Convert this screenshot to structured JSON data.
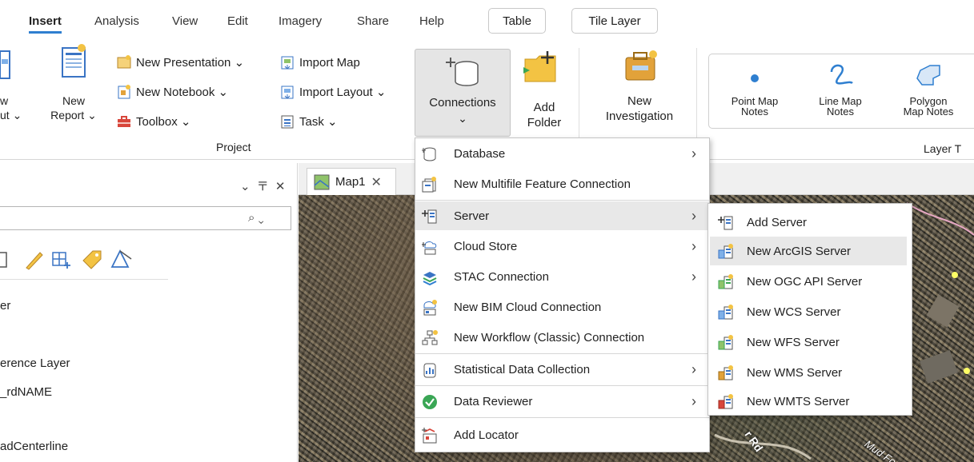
{
  "tabs": [
    "Insert",
    "Analysis",
    "View",
    "Edit",
    "Imagery",
    "Share",
    "Help"
  ],
  "context_tabs": [
    "Table",
    "Tile Layer"
  ],
  "ribbon": {
    "partial_left_1": "w",
    "partial_left_2": "ut ⌄",
    "new_report_1": "New",
    "new_report_2": "Report ⌄",
    "new_presentation": "New Presentation ⌄",
    "new_notebook": "New Notebook ⌄",
    "toolbox": "Toolbox ⌄",
    "import_map": "Import Map",
    "import_layout": "Import Layout ⌄",
    "task": "Task ⌄",
    "project_group": "Project",
    "connections": "Connections",
    "connections_arrow": "⌄",
    "add_folder_1": "Add",
    "add_folder_2": "Folder",
    "new_investigation_1": "New",
    "new_investigation_2": "Investigation",
    "point_notes_1": "Point Map",
    "point_notes_2": "Notes",
    "line_notes_1": "Line Map",
    "line_notes_2": "Notes",
    "polygon_notes_1": "Polygon",
    "polygon_notes_2": "Map Notes",
    "layer_group": "Layer T"
  },
  "left_pane": {
    "controls": "⌄  〒  ✕",
    "search_icon": "⌕ ⌄",
    "item_er": "er",
    "item_reference": "erence Layer",
    "item_rdname": "_rdNAME",
    "item_centerline": "adCenterline"
  },
  "map": {
    "tab_label": "Map1",
    "road_label_1": "r Rd",
    "road_label_2": "Mud Fo"
  },
  "connections_menu": [
    {
      "label": "Database",
      "submenu": true,
      "icon": "database-icon"
    },
    {
      "label": "New Multifile Feature Connection",
      "submenu": false,
      "icon": "multifile-icon"
    },
    {
      "label": "Server",
      "submenu": true,
      "icon": "server-icon"
    },
    {
      "label": "Cloud Store",
      "submenu": true,
      "icon": "cloud-store-icon"
    },
    {
      "label": "STAC Connection",
      "submenu": true,
      "icon": "stac-icon"
    },
    {
      "label": "New BIM Cloud Connection",
      "submenu": false,
      "icon": "bim-icon"
    },
    {
      "label": "New Workflow (Classic) Connection",
      "submenu": false,
      "icon": "workflow-icon"
    },
    {
      "label": "Statistical Data Collection",
      "submenu": true,
      "icon": "statistical-icon"
    },
    {
      "label": "Data Reviewer",
      "submenu": true,
      "icon": "reviewer-icon"
    },
    {
      "label": "Add Locator",
      "submenu": false,
      "icon": "locator-icon"
    }
  ],
  "server_menu": [
    {
      "label": "Add Server",
      "icon": "add-server-icon"
    },
    {
      "label": "New ArcGIS Server",
      "icon": "arcgis-server-icon"
    },
    {
      "label": "New OGC API Server",
      "icon": "ogc-server-icon"
    },
    {
      "label": "New WCS Server",
      "icon": "wcs-server-icon"
    },
    {
      "label": "New WFS Server",
      "icon": "wfs-server-icon"
    },
    {
      "label": "New WMS Server",
      "icon": "wms-server-icon"
    },
    {
      "label": "New WMTS Server",
      "icon": "wmts-server-icon"
    }
  ],
  "colors": {
    "accent": "#2f7fd0",
    "highlight": "#e8e8e8",
    "reviewer_green": "#3aa655"
  }
}
